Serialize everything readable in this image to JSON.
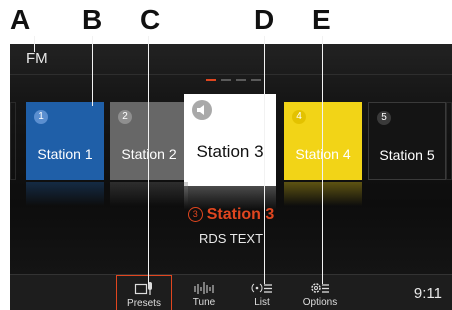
{
  "callouts": [
    "A",
    "B",
    "C",
    "D",
    "E"
  ],
  "source": "FM",
  "stations": [
    {
      "num": "1",
      "name": "Station 1",
      "color": "#1f5fa8"
    },
    {
      "num": "2",
      "name": "Station 2",
      "color": "#676767"
    },
    {
      "num": "3",
      "name": "Station 3",
      "color": "#ffffff"
    },
    {
      "num": "4",
      "name": "Station 4",
      "color": "#f2d417"
    },
    {
      "num": "5",
      "name": "Station 5",
      "color": "#141414"
    }
  ],
  "now_playing": {
    "num": "3",
    "name": "Station 3",
    "rds": "RDS TEXT"
  },
  "nav": [
    {
      "label": "Presets",
      "icon": "presets-icon",
      "active": true
    },
    {
      "label": "Tune",
      "icon": "tune-icon",
      "active": false
    },
    {
      "label": "List",
      "icon": "list-icon",
      "active": false
    },
    {
      "label": "Options",
      "icon": "options-icon",
      "active": false
    }
  ],
  "clock": "9:11",
  "accent": "#e0461f"
}
